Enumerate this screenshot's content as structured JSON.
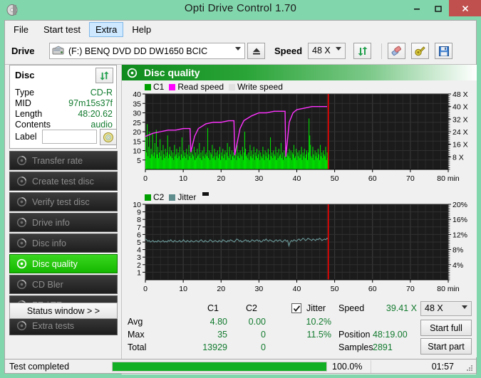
{
  "window": {
    "title": "Opti Drive Control 1.70",
    "icon": "disc-icon",
    "minimize_label": "–",
    "maximize_label": "▭",
    "close_label": "✕",
    "titlebar_color": "#82d6ac",
    "close_color": "#c0504d"
  },
  "menu": {
    "items": [
      {
        "label": "File",
        "active": false
      },
      {
        "label": "Start test",
        "active": false
      },
      {
        "label": "Extra",
        "active": true
      },
      {
        "label": "Help",
        "active": false
      }
    ]
  },
  "toolbar": {
    "drive_label": "Drive",
    "drive_value": "(F:)   BENQ DVD DD DW1650 BCIC",
    "drive_icon": "drive-icon",
    "eject_icon": "eject-icon",
    "speed_label": "Speed",
    "speed_value": "48 X",
    "refresh_icon": "refresh-icon",
    "erase_icon": "erase-icon",
    "tools_icon": "tools-icon",
    "save_icon": "save-icon"
  },
  "disc_panel": {
    "header": "Disc",
    "refresh_icon": "refresh-icon",
    "rows": [
      {
        "key": "Type",
        "value": "CD-R"
      },
      {
        "key": "MID",
        "value": "97m15s37f"
      },
      {
        "key": "Length",
        "value": "48:20.62"
      },
      {
        "key": "Contents",
        "value": "audio"
      }
    ],
    "label_key": "Label",
    "label_value": "",
    "label_placeholder": "",
    "label_button_icon": "cd-icon"
  },
  "nav": {
    "items": [
      {
        "label": "Transfer rate",
        "icon": "disc-icon",
        "selected": false
      },
      {
        "label": "Create test disc",
        "icon": "disc-icon",
        "selected": false
      },
      {
        "label": "Verify test disc",
        "icon": "disc-icon",
        "selected": false
      },
      {
        "label": "Drive info",
        "icon": "disc-icon",
        "selected": false
      },
      {
        "label": "Disc info",
        "icon": "disc-icon",
        "selected": false
      },
      {
        "label": "Disc quality",
        "icon": "disc-icon",
        "selected": true
      },
      {
        "label": "CD Bler",
        "icon": "disc-icon",
        "selected": false
      },
      {
        "label": "FE / TE",
        "icon": "disc-icon",
        "selected": false
      },
      {
        "label": "Extra tests",
        "icon": "disc-icon",
        "selected": false
      }
    ],
    "status_window_label": "Status window > >"
  },
  "content": {
    "header": "Disc quality",
    "header_icon": "disc-quality-icon"
  },
  "stats": {
    "col_c1": "C1",
    "col_c2": "C2",
    "jitter_label": "Jitter",
    "jitter_checked": true,
    "rows": [
      {
        "name": "Avg",
        "c1": "4.80",
        "c2": "0.00",
        "jitter": "10.2%"
      },
      {
        "name": "Max",
        "c1": "35",
        "c2": "0",
        "jitter": "11.5%"
      },
      {
        "name": "Total",
        "c1": "13929",
        "c2": "0",
        "jitter": ""
      }
    ],
    "speed_label": "Speed",
    "speed_value": "39.41 X",
    "position_label": "Position",
    "position_value": "48:19.00",
    "samples_label": "Samples",
    "samples_value": "2891",
    "speed_select": "48 X",
    "start_full": "Start full",
    "start_part": "Start part"
  },
  "statusbar": {
    "text": "Test completed",
    "percent_label": "100.0%",
    "percent": 100,
    "time": "01:57",
    "bar_color": "#12ae24"
  },
  "chart_data": [
    {
      "type": "area",
      "id": "c1-read-speed",
      "title": "Disc quality",
      "xlabel": "min",
      "ylabel": "C1",
      "xlim": [
        0,
        80
      ],
      "ylim": [
        0,
        40
      ],
      "xticks": [
        0,
        10,
        20,
        30,
        40,
        50,
        60,
        70,
        80
      ],
      "xtick_labels": [
        "0",
        "10",
        "20",
        "30",
        "40",
        "50",
        "60",
        "70",
        "80 min"
      ],
      "yticks": [
        5,
        10,
        15,
        20,
        25,
        30,
        35,
        40
      ],
      "ytick_labels": [
        "5",
        "10",
        "15",
        "20",
        "25",
        "30",
        "35",
        "40"
      ],
      "y2ticks": [
        8,
        16,
        24,
        32,
        40,
        48
      ],
      "y2tick_labels": [
        "8 X",
        "16 X",
        "24 X",
        "32 X",
        "40 X",
        "48 X"
      ],
      "y2lim": [
        0,
        48
      ],
      "grid": true,
      "legend": [
        {
          "name": "C1",
          "color": "#00a000"
        },
        {
          "name": "Read speed",
          "color": "#ff00ff"
        },
        {
          "name": "Write speed",
          "color": "#e0e0e0"
        }
      ],
      "marker_x": 48.32,
      "marker_color": "#ff0000",
      "series": [
        {
          "name": "C1",
          "color": "#00e000",
          "kind": "bars",
          "x_end": 48.32,
          "values": [
            17,
            9,
            24,
            7,
            12,
            20,
            6,
            11,
            8,
            19,
            7,
            9,
            14,
            6,
            21,
            8,
            12,
            6,
            9,
            16,
            7,
            10,
            5,
            13,
            8,
            6,
            11,
            7,
            9,
            18,
            6,
            8,
            12,
            7,
            10,
            6,
            9,
            5,
            13,
            7,
            8,
            11,
            6,
            9,
            7,
            12,
            5,
            8,
            17,
            6,
            10,
            7,
            9,
            6,
            11,
            8,
            5,
            13,
            7,
            9,
            6,
            10,
            8,
            7,
            12,
            5,
            9,
            6,
            11,
            7,
            8,
            14,
            6,
            9,
            5,
            10,
            7,
            12,
            6,
            8,
            9,
            7,
            22,
            6,
            10,
            5,
            9,
            8,
            13,
            6,
            7,
            11,
            5,
            9,
            7,
            10,
            6,
            8,
            12,
            5,
            9,
            7,
            11,
            6,
            8,
            10,
            5,
            9,
            14,
            7,
            6,
            12,
            8,
            5,
            10,
            7,
            9,
            6,
            11,
            8,
            5,
            13,
            7,
            9,
            6,
            10,
            8,
            7,
            12,
            5,
            9,
            20,
            11,
            7,
            8,
            6,
            9,
            5,
            13,
            7,
            10,
            6,
            8,
            12,
            5,
            9,
            7,
            11,
            6,
            8,
            10,
            5,
            9,
            7,
            6,
            12,
            8,
            5,
            10,
            7,
            9,
            6,
            11,
            8,
            5,
            17,
            7,
            9,
            6,
            10,
            8,
            7,
            12,
            5,
            9,
            6,
            11,
            7,
            8,
            14,
            6,
            9,
            5,
            10,
            7,
            12,
            6,
            8,
            9,
            7,
            11,
            6,
            10,
            5,
            9,
            8,
            13,
            6,
            7,
            11,
            5,
            9,
            7,
            10,
            6,
            8,
            12,
            5,
            9,
            7,
            11,
            6,
            8,
            10,
            5,
            9,
            27,
            18,
            13,
            7,
            6,
            12,
            8,
            5,
            10,
            7,
            9,
            6,
            11,
            8,
            5,
            13,
            7,
            9,
            6,
            10,
            8,
            7,
            12,
            5,
            9,
            6
          ]
        },
        {
          "name": "Read speed",
          "color": "#ff33ff",
          "kind": "line",
          "units": "X",
          "x_end": 48.32,
          "points": [
            [
              0,
              21
            ],
            [
              2,
              23
            ],
            [
              4,
              24
            ],
            [
              6,
              25
            ],
            [
              8,
              25
            ],
            [
              10,
              26
            ],
            [
              11.8,
              26
            ],
            [
              12,
              11
            ],
            [
              13,
              21
            ],
            [
              14,
              26
            ],
            [
              16,
              29
            ],
            [
              18,
              30
            ],
            [
              20,
              30
            ],
            [
              22,
              31
            ],
            [
              23.4,
              31
            ],
            [
              23.6,
              9
            ],
            [
              25,
              26
            ],
            [
              26,
              31
            ],
            [
              28,
              34
            ],
            [
              30,
              36
            ],
            [
              32,
              36
            ],
            [
              34,
              37
            ],
            [
              36,
              37
            ],
            [
              36.9,
              37
            ],
            [
              37.1,
              8
            ],
            [
              38,
              30
            ],
            [
              39,
              36
            ],
            [
              40,
              38
            ],
            [
              42,
              39
            ],
            [
              44,
              40
            ],
            [
              46,
              40
            ],
            [
              48,
              40
            ]
          ]
        }
      ]
    },
    {
      "type": "line",
      "id": "c2-jitter",
      "xlabel": "min",
      "ylabel": "C2",
      "xlim": [
        0,
        80
      ],
      "ylim": [
        0,
        10
      ],
      "xticks": [
        0,
        10,
        20,
        30,
        40,
        50,
        60,
        70,
        80
      ],
      "xtick_labels": [
        "0",
        "10",
        "20",
        "30",
        "40",
        "50",
        "60",
        "70",
        "80 min"
      ],
      "yticks": [
        1,
        2,
        3,
        4,
        5,
        6,
        7,
        8,
        9,
        10
      ],
      "ytick_labels": [
        "1",
        "2",
        "3",
        "4",
        "5",
        "6",
        "7",
        "8",
        "9",
        "10"
      ],
      "y2ticks": [
        4,
        8,
        12,
        16,
        20
      ],
      "y2tick_labels": [
        "4%",
        "8%",
        "12%",
        "16%",
        "20%"
      ],
      "y2lim": [
        0,
        20
      ],
      "grid": true,
      "legend": [
        {
          "name": "C2",
          "color": "#00a000"
        },
        {
          "name": "Jitter",
          "color": "#5f8c8c"
        }
      ],
      "marker_x": 48.32,
      "marker_color": "#ff0000",
      "series": [
        {
          "name": "C2",
          "color": "#00e000",
          "kind": "bars",
          "x_end": 48.32,
          "values": []
        },
        {
          "name": "Jitter",
          "color": "#6d9a9a",
          "kind": "line",
          "units": "%",
          "x_end": 48.32,
          "values": [
            5.4,
            5.3,
            5.1,
            5.2,
            5.0,
            5.1,
            5.2,
            5.0,
            5.1,
            5.0,
            5.2,
            5.1,
            5.0,
            5.1,
            5.2,
            5.0,
            5.1,
            5.0,
            5.2,
            5.1,
            5.3,
            5.1,
            5.0,
            5.2,
            5.1,
            5.0,
            5.1,
            5.2,
            5.0,
            5.1,
            5.3,
            5.1,
            5.0,
            5.2,
            5.1,
            5.0,
            5.2,
            5.1,
            5.0,
            5.1,
            5.2,
            5.1,
            5.0,
            5.2,
            5.3,
            5.1,
            5.0,
            5.2,
            5.1,
            5.0,
            5.1,
            5.3,
            5.2,
            5.0,
            5.1,
            5.2,
            5.1,
            5.0,
            5.2,
            5.1,
            5.0,
            5.3,
            5.2,
            5.1,
            5.0,
            5.2,
            5.1,
            5.3,
            5.2,
            5.1,
            5.0,
            5.2,
            5.4,
            5.3,
            5.1,
            5.2,
            5.0,
            5.1,
            5.2,
            5.3,
            5.1,
            5.2,
            5.0,
            5.1,
            5.3,
            5.2,
            5.1,
            5.2,
            5.3,
            5.1,
            5.2,
            5.0,
            5.1,
            5.3,
            5.2,
            5.4,
            5.2,
            5.1,
            5.3,
            5.2,
            5.1,
            5.0,
            5.2,
            5.3,
            5.1,
            5.2,
            5.3,
            5.1,
            5.0,
            5.2,
            5.3,
            5.1,
            5.2,
            4.5,
            5.0,
            5.2,
            5.1,
            5.3,
            5.2,
            5.1,
            5.3,
            5.4,
            5.2,
            5.3,
            5.5,
            5.4,
            5.2,
            5.3,
            5.5,
            5.4,
            5.3,
            5.2,
            5.4,
            5.3,
            5.2,
            5.4,
            5.3,
            5.5,
            5.4,
            5.2,
            5.3,
            5.4,
            5.3,
            5.5,
            5.4
          ]
        }
      ]
    }
  ]
}
